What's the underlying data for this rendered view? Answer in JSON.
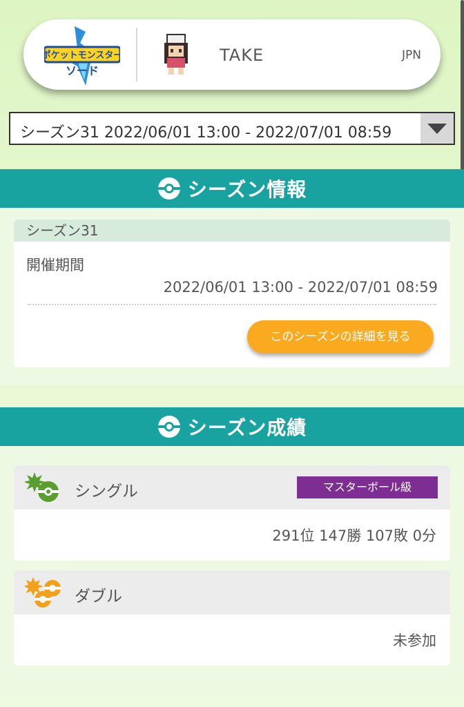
{
  "header": {
    "game_logo_text": "ポケットモンスター ソード",
    "trainer_name": "TAKE",
    "region": "JPN"
  },
  "season_select": {
    "selected": "シーズン31 2022/06/01 13:00 - 2022/07/01 08:59"
  },
  "season_info": {
    "section_title": "シーズン情報",
    "season_name": "シーズン31",
    "period_label": "開催期間",
    "period_value": "2022/06/01 13:00 - 2022/07/01 08:59",
    "detail_button": "このシーズンの詳細を見る"
  },
  "season_results": {
    "section_title": "シーズン成績",
    "single": {
      "label": "シングル",
      "rank_class": "マスターボール級",
      "record": "291位 147勝 107敗 0分"
    },
    "double": {
      "label": "ダブル",
      "record": "未参加"
    }
  },
  "colors": {
    "section_bar": "#19a3a0",
    "detail_button": "#fbaa1f",
    "rank_badge": "#7e2e93",
    "single_icon": "#5a9e2f",
    "double_icon": "#f2a11c"
  }
}
